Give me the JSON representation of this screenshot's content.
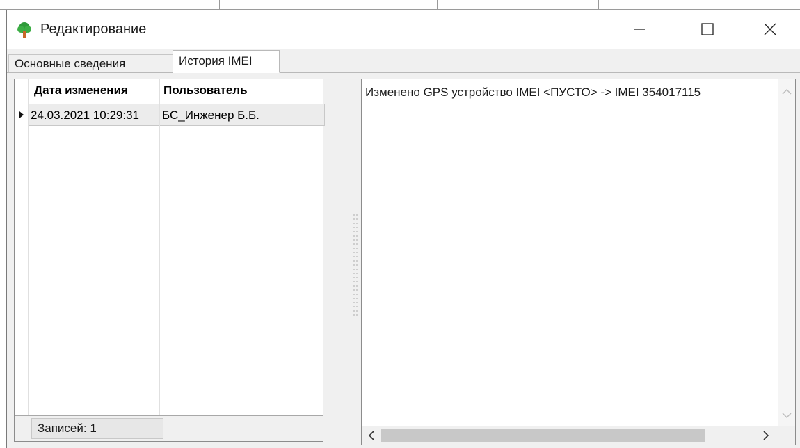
{
  "window": {
    "title": "Редактирование",
    "accent_icon_color": "#c8682a"
  },
  "tabs": [
    {
      "label": "Основные сведения",
      "active": false
    },
    {
      "label": "История IMEI",
      "active": true
    }
  ],
  "history_grid": {
    "columns": [
      "Дата изменения",
      "Пользователь"
    ],
    "rows": [
      {
        "date": "24.03.2021 10:29:31",
        "user": "БС_Инженер Б.Б."
      }
    ],
    "footer": "Записей: 1"
  },
  "details": {
    "text": "Изменено GPS устройство IMEI <ПУСТО> -> IMEI 354017115"
  }
}
